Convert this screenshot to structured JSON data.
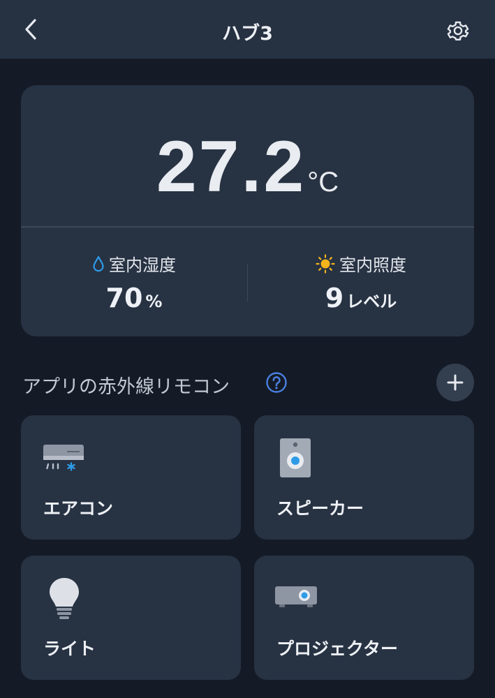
{
  "header": {
    "title": "ハブ3",
    "back_icon": "chevron-left-icon",
    "settings_icon": "gear-icon"
  },
  "sensor": {
    "temperature": "27.2",
    "temperature_unit": "°C",
    "humidity_label": "室内湿度",
    "humidity_value": "70",
    "humidity_unit": "%",
    "humidity_icon": "water-drop-icon",
    "illuminance_label": "室内照度",
    "illuminance_value": "9",
    "illuminance_unit": "レベル",
    "illuminance_icon": "sun-icon"
  },
  "remotes": {
    "section_title": "アプリの赤外線リモコン",
    "help_icon": "help-circle-icon",
    "add_icon": "plus-icon",
    "items": [
      {
        "label": "エアコン",
        "icon": "air-conditioner-icon"
      },
      {
        "label": "スピーカー",
        "icon": "speaker-icon"
      },
      {
        "label": "ライト",
        "icon": "light-bulb-icon"
      },
      {
        "label": "プロジェクター",
        "icon": "projector-icon"
      }
    ]
  },
  "colors": {
    "background": "#141b26",
    "card": "#273243",
    "header": "#263142",
    "accent_blue": "#2e9be8",
    "sun": "#f5b41c"
  }
}
